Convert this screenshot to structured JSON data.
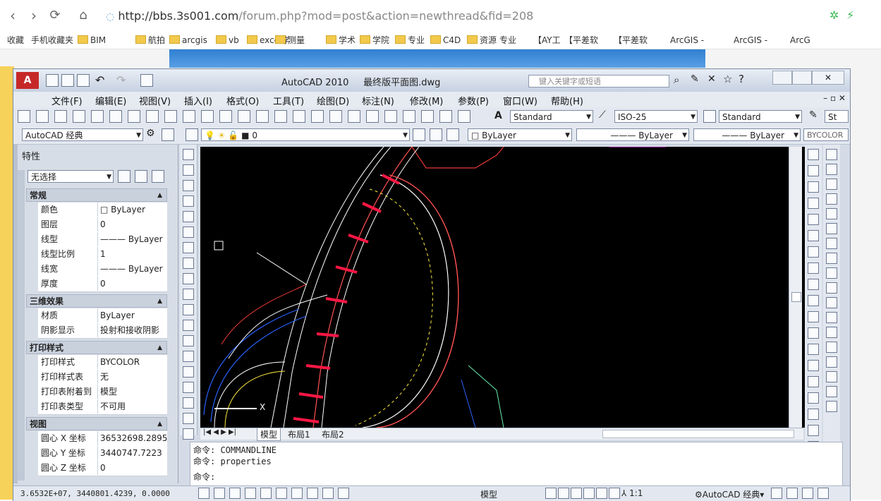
{
  "browser": {
    "url_host": "http://bbs.3s001.com",
    "url_path": "/forum.php?mod=post&action=newthread&fid=208",
    "bookmarks": [
      "收藏",
      "手机收藏夹",
      "BIM",
      "航拍",
      "arcgis",
      "vb",
      "excel学",
      "测量",
      "学术",
      "学院",
      "专业",
      "C4D",
      "资源",
      "专业",
      "【AY工",
      "【平差软",
      "【平差软",
      "ArcGIS -",
      "ArcGIS -",
      "ArcG"
    ]
  },
  "autocad": {
    "title": "AutoCAD 2010",
    "file": "最终版平面图.dwg",
    "search_placeholder": "键入关键字或短语",
    "menus": [
      "文件(F)",
      "编辑(E)",
      "视图(V)",
      "插入(I)",
      "格式(O)",
      "工具(T)",
      "绘图(D)",
      "标注(N)",
      "修改(M)",
      "参数(P)",
      "窗口(W)",
      "帮助(H)"
    ],
    "text_style": "Standard",
    "dim_style": "ISO-25",
    "table_style": "Standard",
    "table_style_extra": "St",
    "workspace": "AutoCAD 经典",
    "layer": "0",
    "color_combo": "ByLayer",
    "linetype_combo": "ByLayer",
    "lineweight_combo": "ByLayer",
    "plotstyle_combo": "BYCOLOR",
    "properties": {
      "title": "特性",
      "selection": "无选择",
      "sections": [
        {
          "name": "常规",
          "rows": [
            {
              "k": "颜色",
              "v": "□ ByLayer"
            },
            {
              "k": "图层",
              "v": "0"
            },
            {
              "k": "线型",
              "v": "——— ByLayer"
            },
            {
              "k": "线型比例",
              "v": "1"
            },
            {
              "k": "线宽",
              "v": "——— ByLayer"
            },
            {
              "k": "厚度",
              "v": "0"
            }
          ]
        },
        {
          "name": "三维效果",
          "rows": [
            {
              "k": "材质",
              "v": "ByLayer"
            },
            {
              "k": "阴影显示",
              "v": "投射和接收阴影"
            }
          ]
        },
        {
          "name": "打印样式",
          "rows": [
            {
              "k": "打印样式",
              "v": "BYCOLOR"
            },
            {
              "k": "打印样式表",
              "v": "无"
            },
            {
              "k": "打印表附着到",
              "v": "模型"
            },
            {
              "k": "打印表类型",
              "v": "不可用"
            }
          ]
        },
        {
          "name": "视图",
          "rows": [
            {
              "k": "圆心 X 坐标",
              "v": "36532698.2895"
            },
            {
              "k": "圆心 Y 坐标",
              "v": "3440747.7223"
            },
            {
              "k": "圆心 Z 坐标",
              "v": "0"
            }
          ]
        }
      ]
    },
    "tabs": [
      "模型",
      "布局1",
      "布局2"
    ],
    "axis_x": "X",
    "command_lines": [
      "命令: COMMANDLINE",
      "命令: properties"
    ],
    "command_prompt": "命令:",
    "status": {
      "coords": "3.6532E+07, 3440801.4239, 0.0000",
      "model": "模型",
      "scale": "1:1",
      "workspace": "AutoCAD 经典"
    }
  }
}
